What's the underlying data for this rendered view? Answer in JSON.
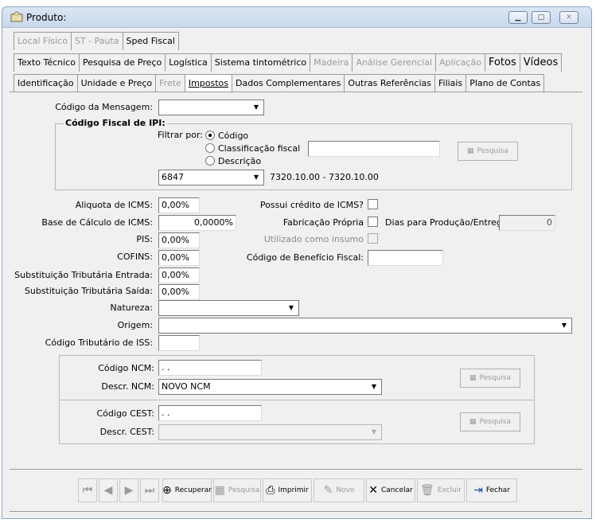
{
  "window": {
    "title": "Produto:"
  },
  "tabs_row1": [
    {
      "label": "Local Físico",
      "state": "disabled"
    },
    {
      "label": "ST - Pauta",
      "state": "disabled"
    },
    {
      "label": "Sped Fiscal",
      "state": "normal"
    }
  ],
  "tabs_row2": [
    {
      "label": "Texto Técnico",
      "state": "normal"
    },
    {
      "label": "Pesquisa de Preço",
      "state": "normal"
    },
    {
      "label": "Logística",
      "state": "normal"
    },
    {
      "label": "Sistema tintométrico",
      "state": "normal"
    },
    {
      "label": "Madeira",
      "state": "disabled"
    },
    {
      "label": "Análise Gerencial",
      "state": "disabled"
    },
    {
      "label": "Aplicação",
      "state": "disabled"
    },
    {
      "label": "Fotos",
      "state": "strong"
    },
    {
      "label": "Vídeos",
      "state": "strong"
    }
  ],
  "tabs_row3": [
    {
      "label": "Identificação",
      "state": "normal"
    },
    {
      "label": "Unidade e Preço",
      "state": "normal"
    },
    {
      "label": "Frete",
      "state": "disabled"
    },
    {
      "label": "Impostos",
      "state": "selected"
    },
    {
      "label": "Dados Complementares",
      "state": "normal"
    },
    {
      "label": "Outras Referências",
      "state": "normal"
    },
    {
      "label": "Filiais",
      "state": "normal"
    },
    {
      "label": "Plano de Contas",
      "state": "normal"
    }
  ],
  "form": {
    "codigo_mensagem_label": "Código da Mensagem:",
    "codigo_mensagem_value": "",
    "ipi_group_title": "Código Fiscal de IPI:",
    "filtrar_label": "Filtrar por:",
    "radio_codigo": "Código",
    "radio_classificacao": "Classificação fiscal",
    "radio_descricao": "Descrição",
    "filtro_value": "",
    "pesquisa_label": "Pesquisa",
    "ipi_code": "6847",
    "ipi_range": "7320.10.00 - 7320.10.00",
    "aliquota_icms_label": "Aliquota de ICMS:",
    "aliquota_icms_value": "0,00%",
    "base_calculo_label": "Base de Cálculo de ICMS:",
    "base_calculo_value": "0,0000%",
    "pis_label": "PIS:",
    "pis_value": "0,00%",
    "cofins_label": "COFINS:",
    "cofins_value": "0,00%",
    "st_entrada_label": "Substituição Tributária Entrada:",
    "st_entrada_value": "0,00%",
    "st_saida_label": "Substituição Tributária Saída:",
    "st_saida_value": "0,00%",
    "natureza_label": "Natureza:",
    "natureza_value": "",
    "origem_label": "Origem:",
    "origem_value": "",
    "iss_label": "Código Tributário de ISS:",
    "iss_value": "",
    "credito_icms_label": "Possui crédito de ICMS?",
    "fabricacao_label": "Fabricação Própria",
    "dias_producao_label": "Dias para Produção/Entrega:",
    "dias_producao_value": "0",
    "insumo_label": "Utilizado como insumo",
    "beneficio_label": "Código de Benefício Fiscal:",
    "beneficio_value": "",
    "ncm_label": "Código NCM:",
    "ncm_value": "  .  .",
    "descr_ncm_label": "Descr. NCM:",
    "descr_ncm_value": "NOVO NCM",
    "cest_label": "Código CEST:",
    "cest_value": "  .  .",
    "descr_cest_label": "Descr. CEST:",
    "descr_cest_value": ""
  },
  "toolbar": {
    "recuperar": "Recuperar",
    "pesquisa": "Pesquisa",
    "imprimir": "Imprimir",
    "novo": "Novo",
    "cancelar": "Cancelar",
    "excluir": "Excluir",
    "fechar": "Fechar"
  },
  "icons": {
    "app": "product-icon",
    "minimize": "minimize-icon",
    "maximize": "maximize-icon",
    "close": "close-icon"
  }
}
